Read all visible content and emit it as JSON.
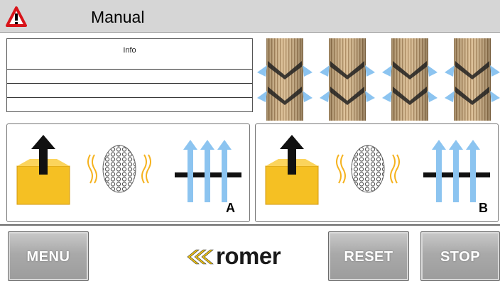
{
  "header": {
    "title": "Manual",
    "alarm_icon": "warning-triangle-icon"
  },
  "info_panel": {
    "title": "Info",
    "rows": [
      "",
      "",
      ""
    ]
  },
  "stations": [
    {
      "letter": "A"
    },
    {
      "letter": "B"
    }
  ],
  "footer": {
    "menu_label": "MENU",
    "reset_label": "RESET",
    "stop_label": "STOP",
    "logo_text": "romer"
  },
  "colors": {
    "titlebar": "#d6d6d6",
    "box_yellow": "#f5c023",
    "arrow_blue": "#8cc4f0",
    "logo_yellow": "#f1c40f"
  }
}
